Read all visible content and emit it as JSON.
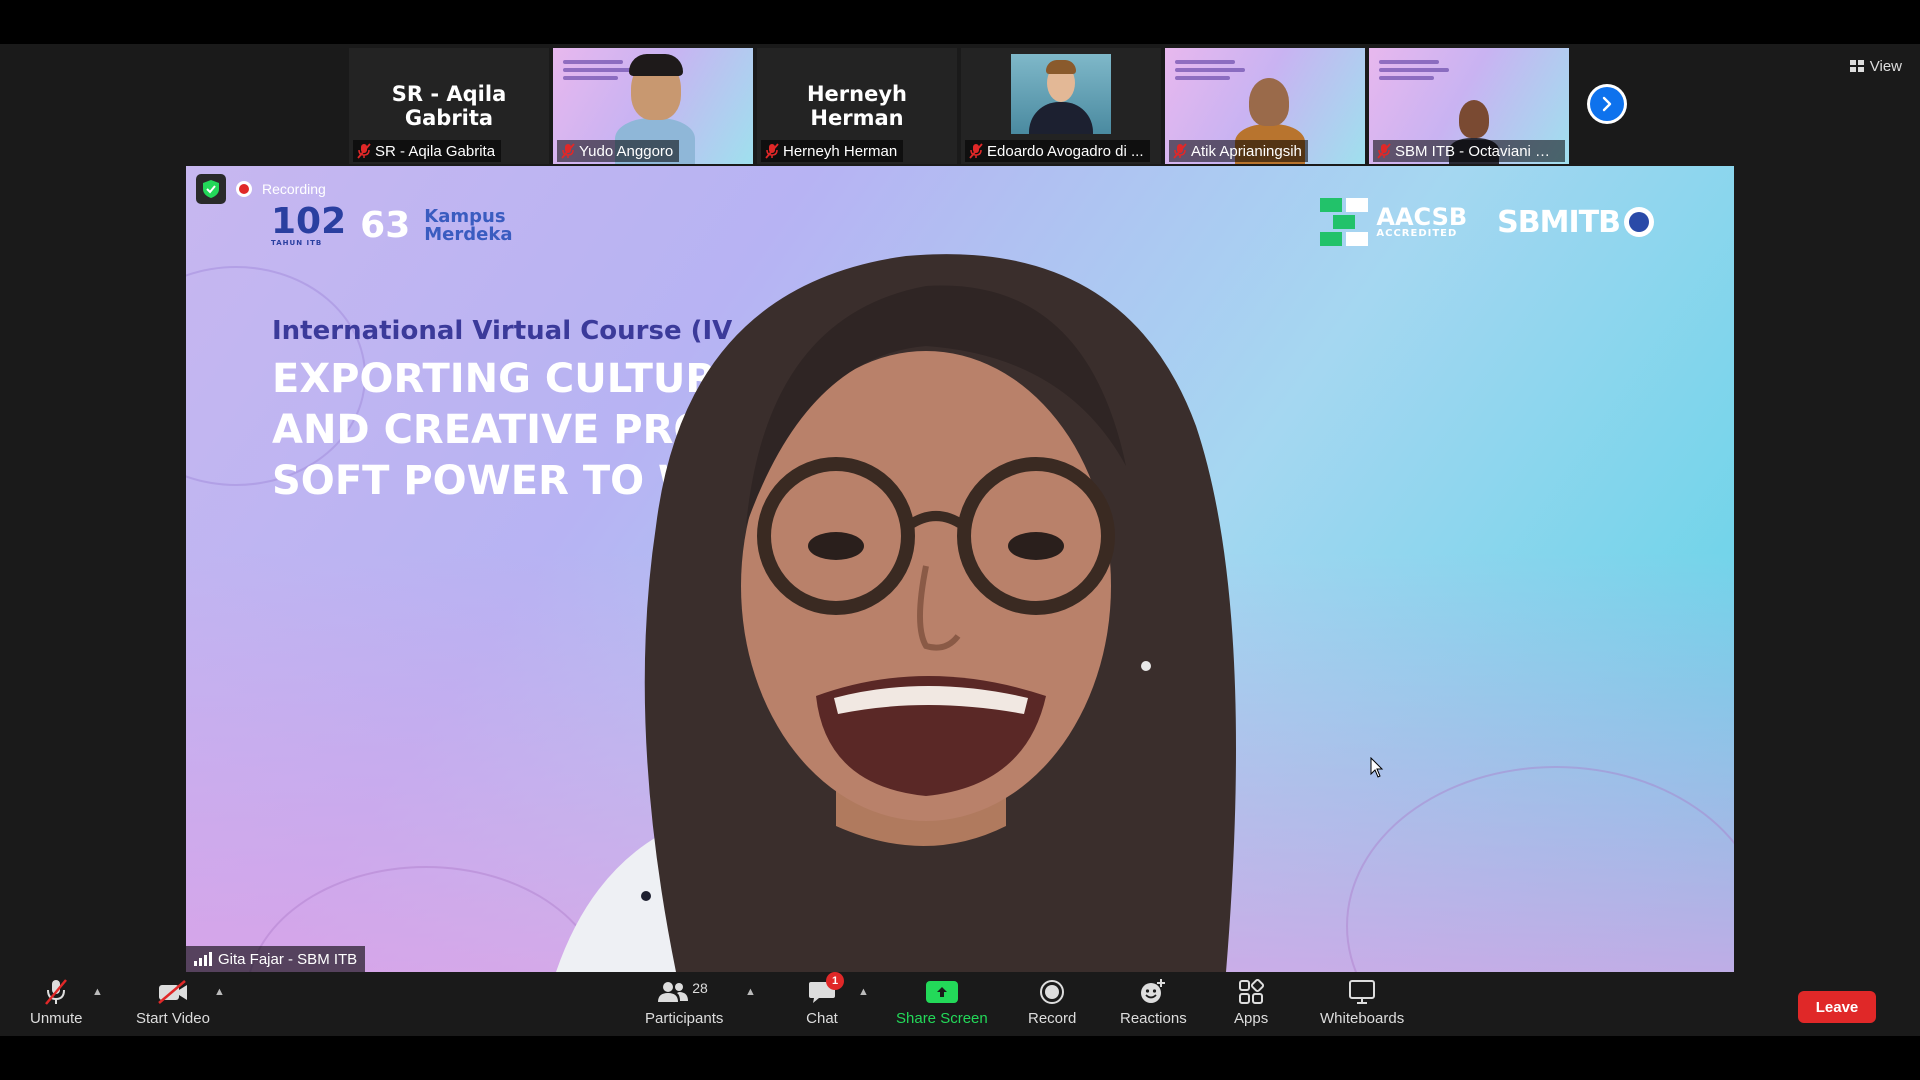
{
  "filmstrip": {
    "tiles": [
      {
        "display_name": "SR - Aqila Gabrita",
        "label": "SR - Aqila Gabrita",
        "muted": true,
        "video": false
      },
      {
        "label": "Yudo Anggoro",
        "muted": true,
        "video": true
      },
      {
        "display_name": "Herneyh Herman",
        "label": "Herneyh Herman",
        "muted": true,
        "video": false
      },
      {
        "label": "Edoardo Avogadro di ...",
        "muted": true,
        "video": true
      },
      {
        "label": "Atik Aprianingsih",
        "muted": true,
        "video": true
      },
      {
        "label": "SBM ITB - Octaviani R. ...",
        "muted": true,
        "video": true
      }
    ],
    "next_icon": "chevron-right-icon"
  },
  "view_button": {
    "label": "View",
    "icon": "grid-icon"
  },
  "main_video": {
    "recording_label": "Recording",
    "speaker_label": "Gita Fajar - SBM ITB",
    "slide": {
      "logo_left_1": "102",
      "logo_left_1_sub": "TAHUN ITB",
      "logo_left_2": "63",
      "logo_left_3": "Kampus Merdeka",
      "logo_right_1": "AACSB",
      "logo_right_1_sub": "ACCREDITED",
      "logo_right_2": "SBMITB",
      "subtitle": "International Virtual Course (IV",
      "title_lines": [
        "EXPORTING CULTUR",
        "AND CREATIVE PRO",
        "SOFT POWER TO W"
      ]
    }
  },
  "toolbar": {
    "unmute_label": "Unmute",
    "start_video_label": "Start Video",
    "participants_label": "Participants",
    "participants_count": "28",
    "chat_label": "Chat",
    "chat_badge": "1",
    "share_screen_label": "Share Screen",
    "record_label": "Record",
    "reactions_label": "Reactions",
    "apps_label": "Apps",
    "whiteboards_label": "Whiteboards",
    "leave_label": "Leave"
  },
  "colors": {
    "accent_blue": "#0e72ed",
    "share_green": "#23d959",
    "leave_red": "#e02828",
    "mute_red": "#e02828"
  }
}
